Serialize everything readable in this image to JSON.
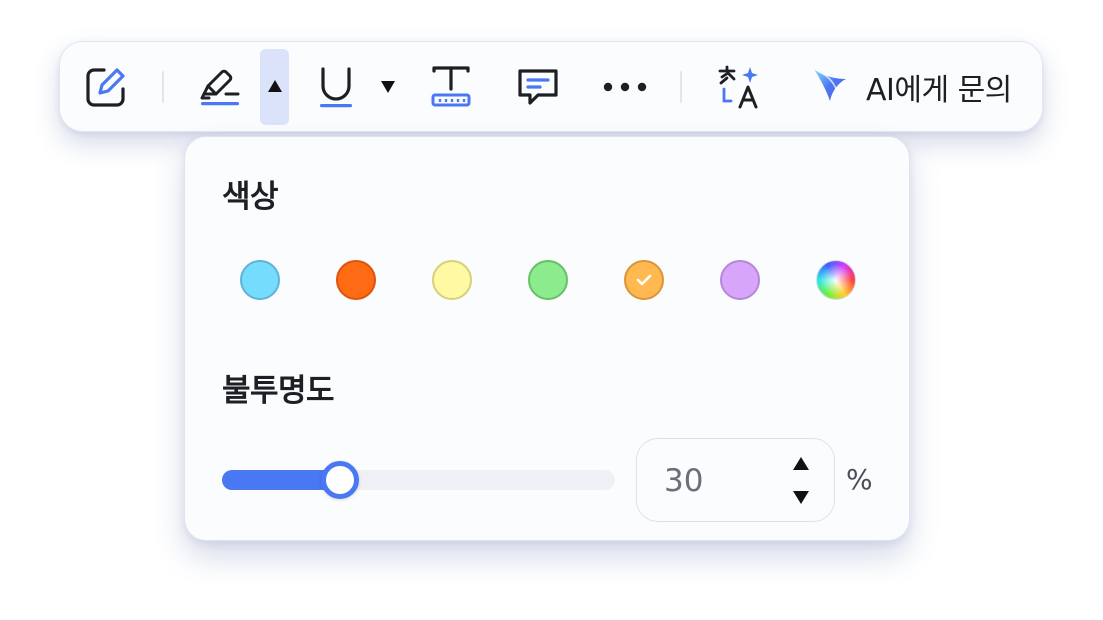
{
  "toolbar": {
    "ai_button_label": "AI에게 문의",
    "icons": [
      "edit-icon",
      "highlighter-icon",
      "caret-up-icon",
      "underline-icon",
      "caret-down-icon",
      "text-box-icon",
      "comment-icon",
      "more-icon",
      "translate-icon",
      "ai-sparkle-icon"
    ],
    "accent_color": "#4a77f2"
  },
  "panel": {
    "color_title": "색상",
    "opacity_title": "불투명도",
    "swatches": [
      {
        "name": "sky-blue",
        "fill": "#76dcfd",
        "border": "#5eb3d6"
      },
      {
        "name": "orange",
        "fill": "#ff6a14",
        "border": "#d9560c"
      },
      {
        "name": "light-yellow",
        "fill": "#fff9a3",
        "border": "#d9cf7a"
      },
      {
        "name": "light-green",
        "fill": "#8ceb8c",
        "border": "#66c066"
      },
      {
        "name": "light-orange",
        "fill": "#ffb950",
        "border": "#d9953a",
        "selected": true
      },
      {
        "name": "lavender",
        "fill": "#d7a6fb",
        "border": "#b687d9"
      },
      {
        "name": "rainbow-picker",
        "fill": "conic-gradient",
        "border": "#d8dbe4"
      }
    ],
    "opacity": {
      "value": "30",
      "unit": "%",
      "fraction": 0.3
    }
  }
}
